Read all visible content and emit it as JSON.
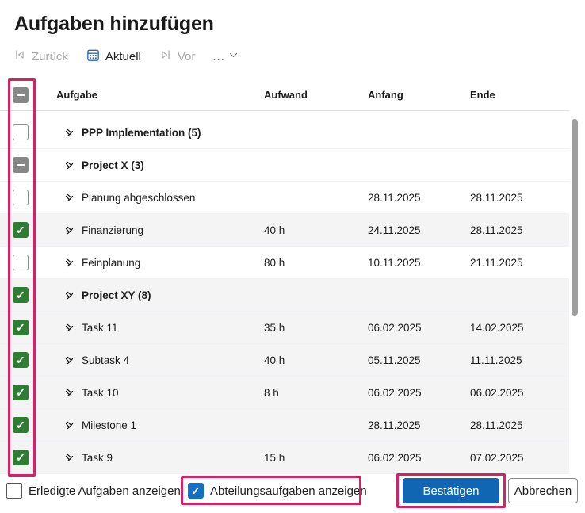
{
  "title": "Aufgaben hinzufügen",
  "toolbar": {
    "back_label": "Zurück",
    "today_label": "Aktuell",
    "forward_label": "Vor",
    "overflow_label": "..."
  },
  "table": {
    "columns": {
      "aufgabe": "Aufgabe",
      "aufwand": "Aufwand",
      "anfang": "Anfang",
      "ende": "Ende"
    },
    "header_checkbox_state": "indeterminate",
    "rows": [
      {
        "name": "PPP Implementation (5)",
        "type": "group",
        "expanded": false,
        "checkbox": "unchecked",
        "aufwand": "",
        "anfang": "",
        "ende": "",
        "selected": false
      },
      {
        "name": "Project X (3)",
        "type": "group",
        "expanded": true,
        "checkbox": "indeterminate",
        "aufwand": "",
        "anfang": "",
        "ende": "",
        "selected": false
      },
      {
        "name": "Planung abgeschlossen",
        "type": "task",
        "expanded": null,
        "checkbox": "unchecked",
        "aufwand": "",
        "anfang": "28.11.2025",
        "ende": "28.11.2025",
        "selected": false
      },
      {
        "name": "Finanzierung",
        "type": "task",
        "expanded": null,
        "checkbox": "checked",
        "aufwand": "40 h",
        "anfang": "24.11.2025",
        "ende": "28.11.2025",
        "selected": true
      },
      {
        "name": "Feinplanung",
        "type": "task",
        "expanded": null,
        "checkbox": "unchecked",
        "aufwand": "80 h",
        "anfang": "10.11.2025",
        "ende": "21.11.2025",
        "selected": false
      },
      {
        "name": "Project XY (8)",
        "type": "group",
        "expanded": true,
        "checkbox": "checked",
        "aufwand": "",
        "anfang": "",
        "ende": "",
        "selected": true
      },
      {
        "name": "Task 11",
        "type": "task",
        "expanded": null,
        "checkbox": "checked",
        "aufwand": "35 h",
        "anfang": "06.02.2025",
        "ende": "14.02.2025",
        "selected": true
      },
      {
        "name": "Subtask 4",
        "type": "task",
        "expanded": null,
        "checkbox": "checked",
        "aufwand": "40 h",
        "anfang": "05.11.2025",
        "ende": "11.11.2025",
        "selected": true
      },
      {
        "name": "Task 10",
        "type": "task",
        "expanded": null,
        "checkbox": "checked",
        "aufwand": "8 h",
        "anfang": "06.02.2025",
        "ende": "06.02.2025",
        "selected": true
      },
      {
        "name": "Milestone 1",
        "type": "task",
        "expanded": null,
        "checkbox": "checked",
        "aufwand": "",
        "anfang": "28.11.2025",
        "ende": "28.11.2025",
        "selected": true
      },
      {
        "name": "Task 9",
        "type": "task",
        "expanded": null,
        "checkbox": "checked",
        "aufwand": "15 h",
        "anfang": "06.02.2025",
        "ende": "07.02.2025",
        "selected": true
      }
    ]
  },
  "footer": {
    "show_completed": {
      "label": "Erledigte Aufgaben anzeigen",
      "checked": false
    },
    "show_department": {
      "label": "Abteilungsaufgaben anzeigen",
      "checked": true
    },
    "confirm_label": "Bestätigen",
    "cancel_label": "Abbrechen"
  },
  "colors": {
    "accent_blue": "#1166b3",
    "checkbox_green": "#2f7d33",
    "checkbox_blue": "#1470c4",
    "highlight_magenta": "#d02466",
    "selected_row": "#f4f4f4",
    "calendar_icon_blue": "#2569bd"
  }
}
